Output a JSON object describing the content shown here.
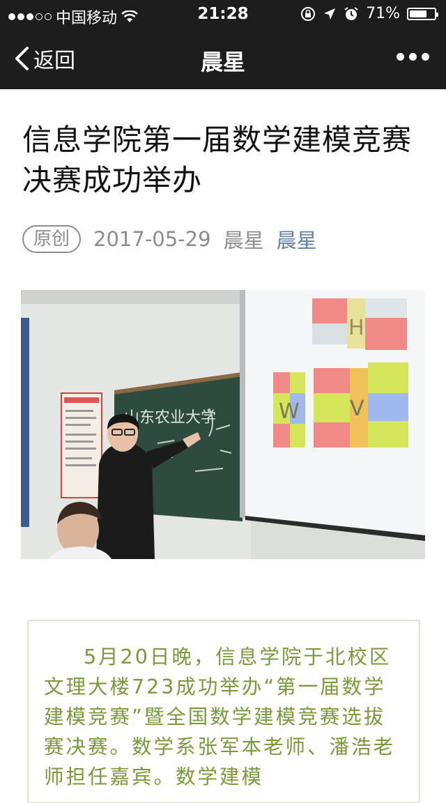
{
  "status_bar": {
    "carrier": "中国移动",
    "time": "21:28",
    "battery": "71%",
    "battery_level": 0.71
  },
  "nav": {
    "back_label": "返回",
    "title": "晨星"
  },
  "article": {
    "title": "信息学院第一届数学建模竞赛决赛成功举办",
    "tag": "原创",
    "date": "2017-05-29",
    "author": "晨星",
    "account": "晨星",
    "board_text": "山东农业大学",
    "slide_letters": [
      "H",
      "W",
      "V"
    ],
    "body_text": "5月20日晚，信息学院于北校区文理大楼723成功举办“第一届数学建模竞赛”暨全国数学建模竞赛选拔赛决赛。数学系张军本老师、潘浩老师担任嘉宾。数学建模"
  },
  "colors": {
    "bar_bg": "#1d1d1d",
    "link": "#607fa6",
    "body_text": "#7a9a3a"
  }
}
